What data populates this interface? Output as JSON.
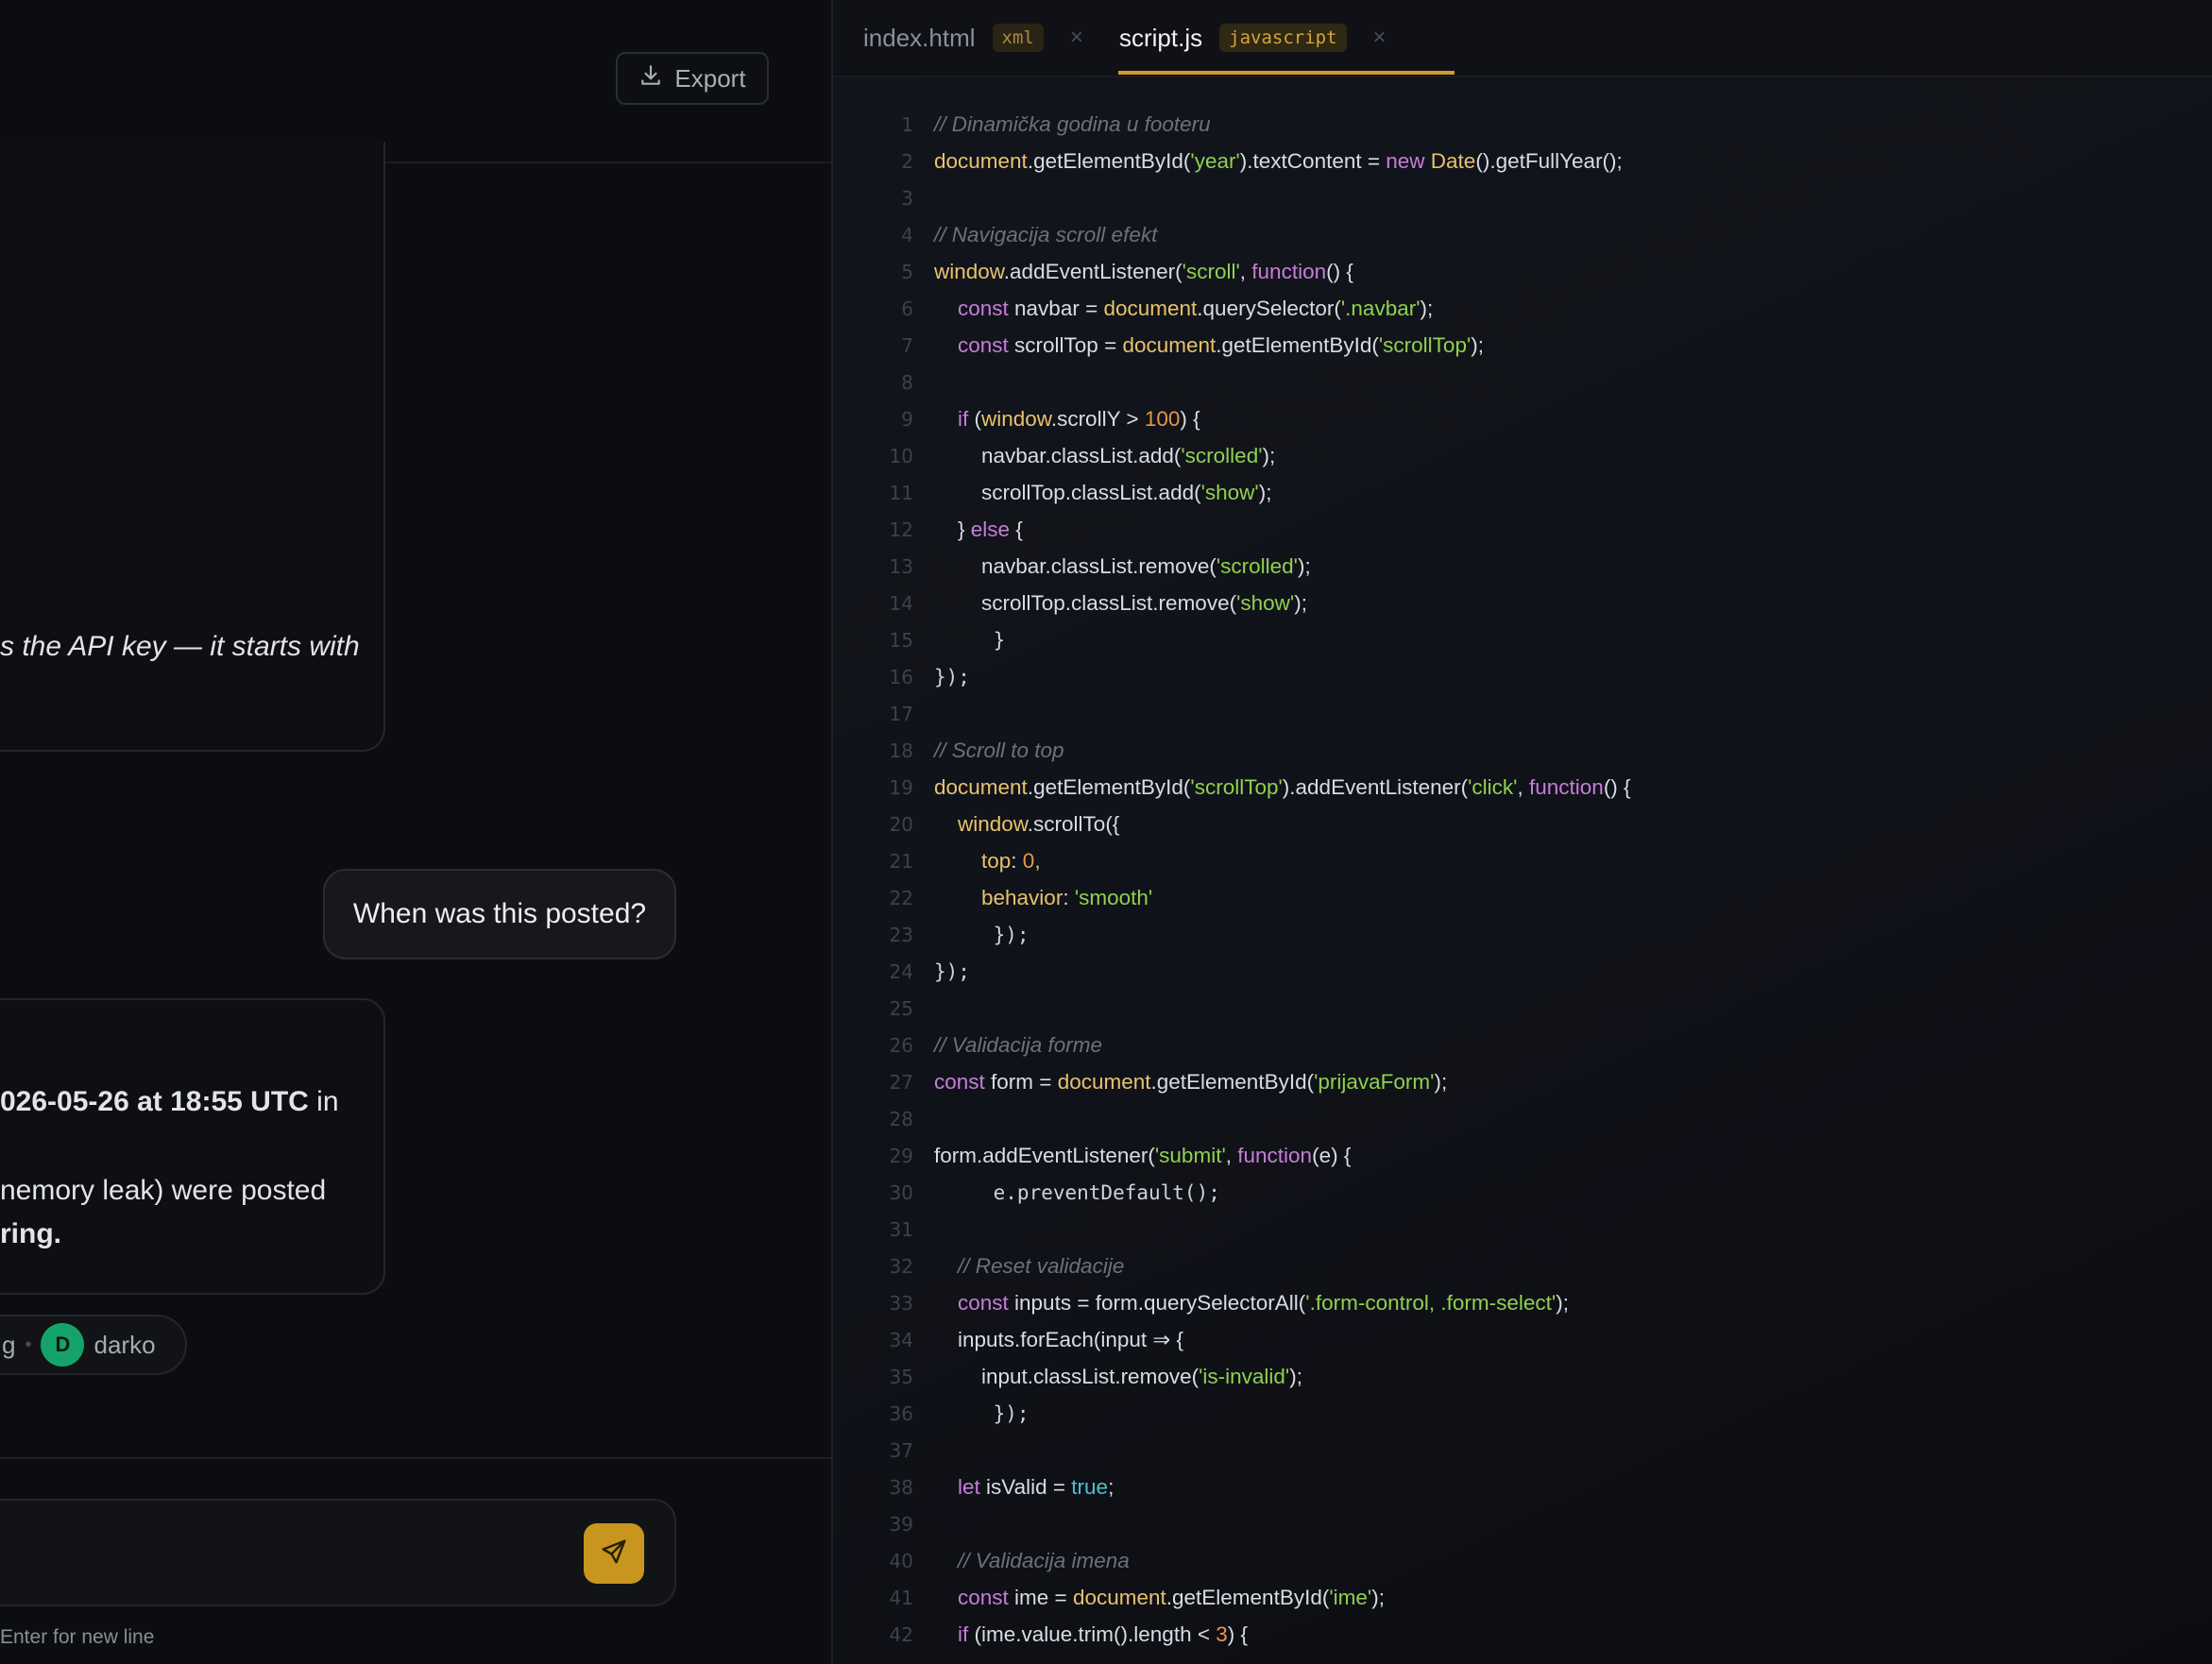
{
  "chat": {
    "export_label": "Export",
    "ai_message_1_fragment": "s the API key — it starts with",
    "user_message": "When was this posted?",
    "ai_message_2": {
      "line1_bold": "026-05-26 at 18:55 UTC",
      "line1_rest": " in",
      "line2": "nemory leak) were posted",
      "line3_bold": "ring."
    },
    "meta": {
      "fragment": "g",
      "avatar_letter": "D",
      "username": "darko"
    },
    "composer_hint": "Enter for new line"
  },
  "editor": {
    "tabs": [
      {
        "name": "index.html",
        "lang": "xml",
        "close": "×"
      },
      {
        "name": "script.js",
        "lang": "javascript",
        "close": "×"
      }
    ],
    "active_tab": "script.js",
    "accent_color": "#d69a2a",
    "code_lines": [
      {
        "n": "1",
        "indent": 0,
        "tokens": [
          [
            "cmt",
            "// Dinamička godina u footeru"
          ]
        ]
      },
      {
        "n": "2",
        "indent": 0,
        "tokens": [
          [
            "obj",
            "document"
          ],
          [
            "",
            "."
          ],
          [
            "",
            "getElementById("
          ],
          [
            "str",
            "'year'"
          ],
          [
            "",
            ").textContent = "
          ],
          [
            "kw",
            "new "
          ],
          [
            "obj",
            "Date"
          ],
          [
            "",
            "().getFullYear();"
          ]
        ]
      },
      {
        "n": "3",
        "indent": 0,
        "tokens": []
      },
      {
        "n": "4",
        "indent": 0,
        "tokens": [
          [
            "cmt",
            "// Navigacija scroll efekt"
          ]
        ]
      },
      {
        "n": "5",
        "indent": 0,
        "tokens": [
          [
            "obj",
            "window"
          ],
          [
            "",
            ".addEventListener("
          ],
          [
            "str",
            "'scroll'"
          ],
          [
            "",
            ", "
          ],
          [
            "kw",
            "function"
          ],
          [
            "",
            "() {"
          ]
        ]
      },
      {
        "n": "6",
        "indent": 1,
        "tokens": [
          [
            "kw",
            "const "
          ],
          [
            "",
            "navbar = "
          ],
          [
            "obj",
            "document"
          ],
          [
            "",
            ".querySelector("
          ],
          [
            "str",
            "'.navbar'"
          ],
          [
            "",
            ");"
          ]
        ]
      },
      {
        "n": "7",
        "indent": 1,
        "tokens": [
          [
            "kw",
            "const "
          ],
          [
            "",
            "scrollTop = "
          ],
          [
            "obj",
            "document"
          ],
          [
            "",
            ".getElementById("
          ],
          [
            "str",
            "'scrollTop'"
          ],
          [
            "",
            ");"
          ]
        ]
      },
      {
        "n": "8",
        "indent": 0,
        "tokens": []
      },
      {
        "n": "9",
        "indent": 1,
        "tokens": [
          [
            "kw",
            "if "
          ],
          [
            "",
            "("
          ],
          [
            "obj",
            "window"
          ],
          [
            "",
            ".scrollY > "
          ],
          [
            "num",
            "100"
          ],
          [
            "",
            ") {"
          ]
        ]
      },
      {
        "n": "10",
        "indent": 2,
        "tokens": [
          [
            "",
            "navbar.classList.add("
          ],
          [
            "str",
            "'scrolled'"
          ],
          [
            "",
            ");"
          ]
        ]
      },
      {
        "n": "11",
        "indent": 2,
        "tokens": [
          [
            "",
            "scrollTop.classList.add("
          ],
          [
            "str",
            "'show'"
          ],
          [
            "",
            ");"
          ]
        ]
      },
      {
        "n": "12",
        "indent": 1,
        "tokens": [
          [
            "",
            "} "
          ],
          [
            "kw",
            "else "
          ],
          [
            "",
            "{"
          ]
        ]
      },
      {
        "n": "13",
        "indent": 2,
        "tokens": [
          [
            "",
            "navbar.classList.remove("
          ],
          [
            "str",
            "'scrolled'"
          ],
          [
            "",
            ");"
          ]
        ]
      },
      {
        "n": "14",
        "indent": 2,
        "tokens": [
          [
            "",
            "scrollTop.classList.remove("
          ],
          [
            "str",
            "'show'"
          ],
          [
            "",
            ");"
          ]
        ]
      },
      {
        "n": "15",
        "indent": 2,
        "tokens": [
          [
            "mono",
            " }"
          ]
        ]
      },
      {
        "n": "16",
        "indent": 0,
        "tokens": [
          [
            "mono",
            "});"
          ]
        ]
      },
      {
        "n": "17",
        "indent": 0,
        "tokens": []
      },
      {
        "n": "18",
        "indent": 0,
        "tokens": [
          [
            "cmt",
            "// Scroll to top"
          ]
        ]
      },
      {
        "n": "19",
        "indent": 0,
        "tokens": [
          [
            "obj",
            "document"
          ],
          [
            "",
            ".getElementById("
          ],
          [
            "str",
            "'scrollTop'"
          ],
          [
            "",
            ").addEventListener("
          ],
          [
            "str",
            "'click'"
          ],
          [
            "",
            ", "
          ],
          [
            "kw",
            "function"
          ],
          [
            "",
            "() {"
          ]
        ]
      },
      {
        "n": "20",
        "indent": 1,
        "tokens": [
          [
            "obj",
            "window"
          ],
          [
            "",
            ".scrollTo({"
          ]
        ]
      },
      {
        "n": "21",
        "indent": 2,
        "tokens": [
          [
            "obj",
            "top"
          ],
          [
            "",
            ": "
          ],
          [
            "num",
            "0"
          ],
          [
            "obj",
            ","
          ]
        ]
      },
      {
        "n": "22",
        "indent": 2,
        "tokens": [
          [
            "obj",
            "behavior"
          ],
          [
            "",
            ": "
          ],
          [
            "str",
            "'smooth'"
          ]
        ]
      },
      {
        "n": "23",
        "indent": 2,
        "tokens": [
          [
            "mono",
            " });"
          ]
        ]
      },
      {
        "n": "24",
        "indent": 0,
        "tokens": [
          [
            "mono",
            "});"
          ]
        ]
      },
      {
        "n": "25",
        "indent": 0,
        "tokens": []
      },
      {
        "n": "26",
        "indent": 0,
        "tokens": [
          [
            "cmt",
            "// Validacija forme"
          ]
        ]
      },
      {
        "n": "27",
        "indent": 0,
        "tokens": [
          [
            "kw",
            "const "
          ],
          [
            "",
            "form = "
          ],
          [
            "obj",
            "document"
          ],
          [
            "",
            ".getElementById("
          ],
          [
            "str",
            "'prijavaForm'"
          ],
          [
            "",
            ");"
          ]
        ]
      },
      {
        "n": "28",
        "indent": 0,
        "tokens": []
      },
      {
        "n": "29",
        "indent": 0,
        "tokens": [
          [
            "",
            "form.addEventListener("
          ],
          [
            "str",
            "'submit'"
          ],
          [
            "",
            ", "
          ],
          [
            "kw",
            "function"
          ],
          [
            "",
            "(e) {"
          ]
        ]
      },
      {
        "n": "30",
        "indent": 2,
        "tokens": [
          [
            "mono",
            " e.preventDefault();"
          ]
        ]
      },
      {
        "n": "31",
        "indent": 0,
        "tokens": []
      },
      {
        "n": "32",
        "indent": 1,
        "tokens": [
          [
            "cmt",
            "// Reset validacije"
          ]
        ]
      },
      {
        "n": "33",
        "indent": 1,
        "tokens": [
          [
            "kw",
            "const "
          ],
          [
            "",
            "inputs = form.querySelectorAll("
          ],
          [
            "str",
            "'.form-control, .form-select'"
          ],
          [
            "",
            ");"
          ]
        ]
      },
      {
        "n": "34",
        "indent": 1,
        "tokens": [
          [
            "",
            "inputs.forEach(input ⇒ {"
          ]
        ]
      },
      {
        "n": "35",
        "indent": 2,
        "tokens": [
          [
            "",
            "input.classList.remove("
          ],
          [
            "str",
            "'is-invalid'"
          ],
          [
            "",
            ");"
          ]
        ]
      },
      {
        "n": "36",
        "indent": 2,
        "tokens": [
          [
            "mono",
            " });"
          ]
        ]
      },
      {
        "n": "37",
        "indent": 0,
        "tokens": []
      },
      {
        "n": "38",
        "indent": 1,
        "tokens": [
          [
            "kw",
            "let "
          ],
          [
            "",
            "isValid = "
          ],
          [
            "bool",
            "true"
          ],
          [
            "",
            ";"
          ]
        ]
      },
      {
        "n": "39",
        "indent": 0,
        "tokens": []
      },
      {
        "n": "40",
        "indent": 1,
        "tokens": [
          [
            "cmt",
            "// Validacija imena"
          ]
        ]
      },
      {
        "n": "41",
        "indent": 1,
        "tokens": [
          [
            "kw",
            "const "
          ],
          [
            "",
            "ime = "
          ],
          [
            "obj",
            "document"
          ],
          [
            "",
            ".getElementById("
          ],
          [
            "str",
            "'ime'"
          ],
          [
            "",
            ");"
          ]
        ]
      },
      {
        "n": "42",
        "indent": 1,
        "tokens": [
          [
            "kw",
            "if "
          ],
          [
            "",
            "(ime.value.trim().length < "
          ],
          [
            "num",
            "3"
          ],
          [
            "",
            ") {"
          ]
        ]
      }
    ]
  }
}
